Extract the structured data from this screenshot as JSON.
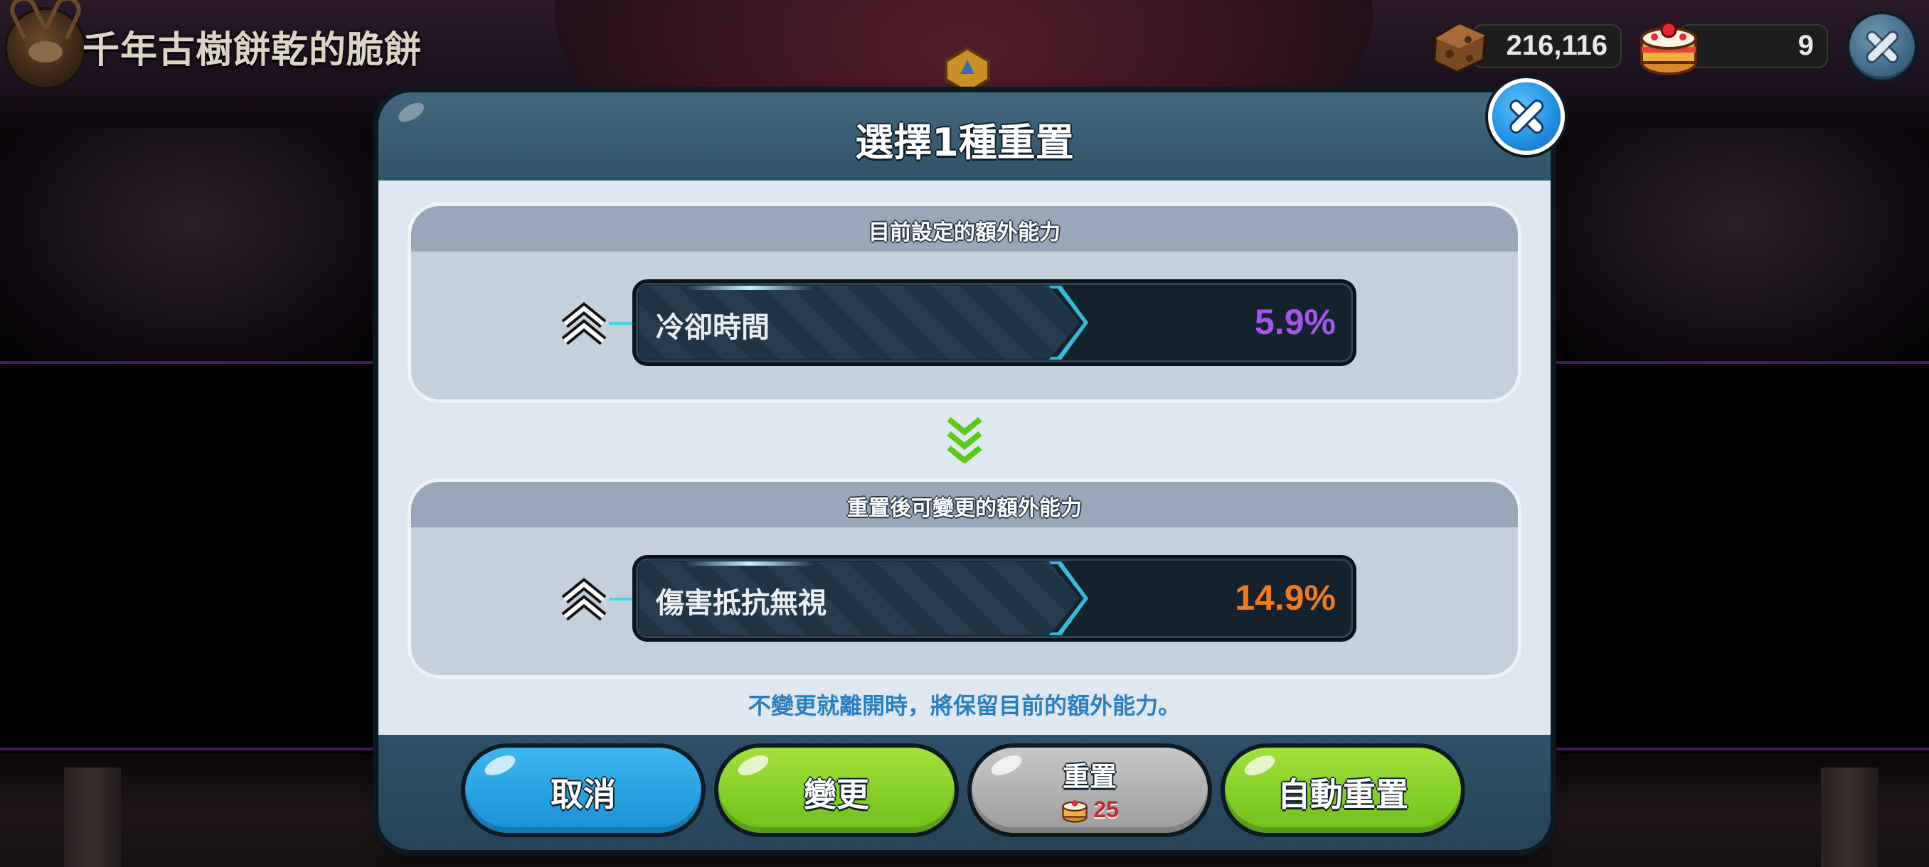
{
  "topbar": {
    "cookie_name": "千年古樹餅乾的脆餅",
    "coins": "216,116",
    "cakes": "9"
  },
  "dialog": {
    "title": "選擇1種重置",
    "current_panel": {
      "header": "目前設定的額外能力",
      "stat_name": "冷卻時間",
      "stat_value": "5.9%"
    },
    "reset_panel": {
      "header": "重置後可變更的額外能力",
      "stat_name": "傷害抵抗無視",
      "stat_value": "14.9%"
    },
    "note": "不變更就離開時，將保留目前的額外能力。"
  },
  "buttons": {
    "cancel": "取消",
    "change": "變更",
    "reset": "重置",
    "reset_cost": "25",
    "auto_reset": "自動重置"
  },
  "colors": {
    "current_value": "#a456e8",
    "reset_value": "#f27a1a",
    "button_blue": "#1890d6",
    "button_green": "#6cc11a",
    "button_gray": "#9c9c9c"
  },
  "icons": {
    "stat_level": "double-chevron-up-icon",
    "transition": "triple-chevron-down-icon",
    "close": "close-icon",
    "coin": "coin-icon",
    "cake": "cake-icon"
  }
}
